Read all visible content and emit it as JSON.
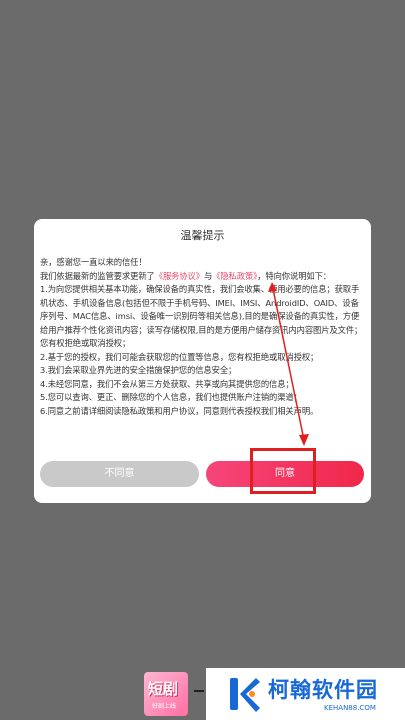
{
  "dialog": {
    "title": "温馨提示",
    "greeting": "亲，感谢您一直以来的信任！",
    "intro_prefix": "我们依据最新的监管要求更新了",
    "service_link": "《服务协议》",
    "and": "与",
    "privacy_link": "《隐私政策》",
    "intro_suffix": "，特向你说明如下：",
    "items": [
      "1.为向您提供相关基本功能，确保设备的真实性，我们会收集、使用必要的信息；获取手机状态、手机设备信息(包括但不限于手机号码、IMEI、IMSI、AndroidID、OAID、设备序列号、MAC信息、imsi、设备唯一识别码等相关信息),目的是确保设备的真实性，方便给用户推荐个性化资讯内容；读写存储权限,目的是方便用户储存资讯内内容图片及文件；您有权拒绝或取消授权；",
      "2.基于您的授权，我们可能会获取您的位置等信息，您有权拒绝或取消授权；",
      "3.我们会采取业界先进的安全措施保护您的信息安全；",
      "4.未经您同意，我们不会从第三方处获取、共享或向其提供您的信息；",
      "5.您可以查询、更正、删除您的个人信息，我们也提供账户注销的渠道；",
      "6.同意之前请详细阅读隐私政策和用户协议，同意则代表授权我们相关声明。"
    ],
    "disagree_label": "不同意",
    "agree_label": "同意"
  },
  "bottom": {
    "app_thumb_text": "短剧",
    "app_thumb_sub": "好剧上线"
  },
  "watermark": {
    "name": "柯翰软件园",
    "url": "KEHAN88.COM"
  },
  "colors": {
    "overlay": "#6b6b6b",
    "link": "#e84a6a",
    "agree": "#f0284a",
    "disagree": "#c9c9c9",
    "annotation": "#e02020",
    "watermark": "#1769d6"
  }
}
